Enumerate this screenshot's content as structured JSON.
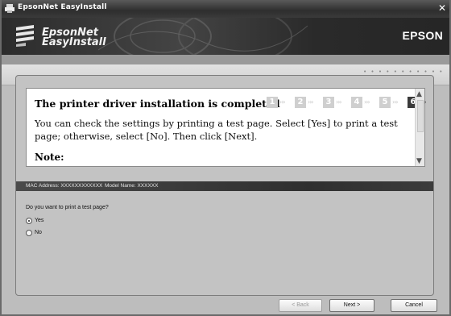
{
  "window": {
    "title": "EpsonNet EasyInstall",
    "close_glyph": "✕"
  },
  "banner": {
    "product_line1": "EpsonNet",
    "product_line2": "EasyInstall",
    "brand": "EPSON"
  },
  "panel": {
    "heading": "The printer driver installation is completed",
    "steps": [
      "1",
      "2",
      "3",
      "4",
      "5",
      "6"
    ],
    "active_step": "6",
    "step_arrows": "›››",
    "body": "You can check the settings by printing a test page. Select [Yes] to print a test page; otherwise, select [No]. Then click [Next].",
    "note": "Note:"
  },
  "device_info": {
    "mac": "MAC Address: XXXXXXXXXXXX",
    "model": "Model Name: XXXXXX"
  },
  "test_page": {
    "question": "Do you want to print a test page?",
    "options": [
      {
        "label": "Yes",
        "checked": true
      },
      {
        "label": "No",
        "checked": false
      }
    ]
  },
  "buttons": {
    "back": "< Back",
    "next": "Next >",
    "cancel": "Cancel"
  },
  "colors": {
    "title_bar": "#3a3a3a",
    "banner": "#333333",
    "panel_bg": "#c3c3c3",
    "active_step": "#3a3a3a"
  }
}
